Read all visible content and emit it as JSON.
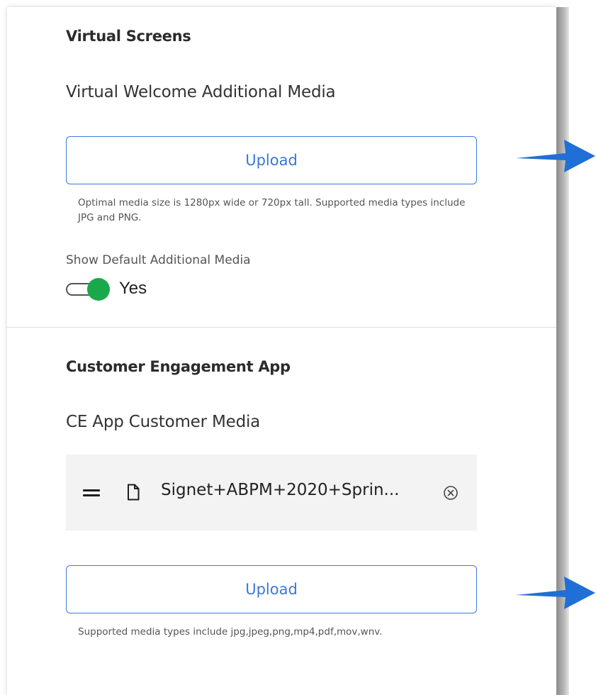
{
  "virtual_screens": {
    "title": "Virtual Screens",
    "additional_media_label": "Virtual Welcome Additional Media",
    "upload_label": "Upload",
    "help_text": "Optimal media size is 1280px wide or 720px tall. Supported media types include JPG and PNG.",
    "toggle_label": "Show Default Additional Media",
    "toggle_state_label": "Yes",
    "toggle_on": true
  },
  "customer_engagement": {
    "title": "Customer Engagement App",
    "media_label": "CE App Customer Media",
    "files": [
      {
        "name": "Signet+ABPM+2020+Sprin..."
      }
    ],
    "upload_label": "Upload",
    "help_text": "Supported media types include jpg,jpeg,png,mp4,pdf,mov,wnv."
  },
  "colors": {
    "accent_blue": "#3b78d8",
    "toggle_green": "#19a94a",
    "arrow_blue": "#1f6fd6"
  },
  "icons": {
    "drag": "drag-handle-icon",
    "file": "file-icon",
    "remove": "remove-circle-icon",
    "arrow": "arrow-right-icon"
  }
}
